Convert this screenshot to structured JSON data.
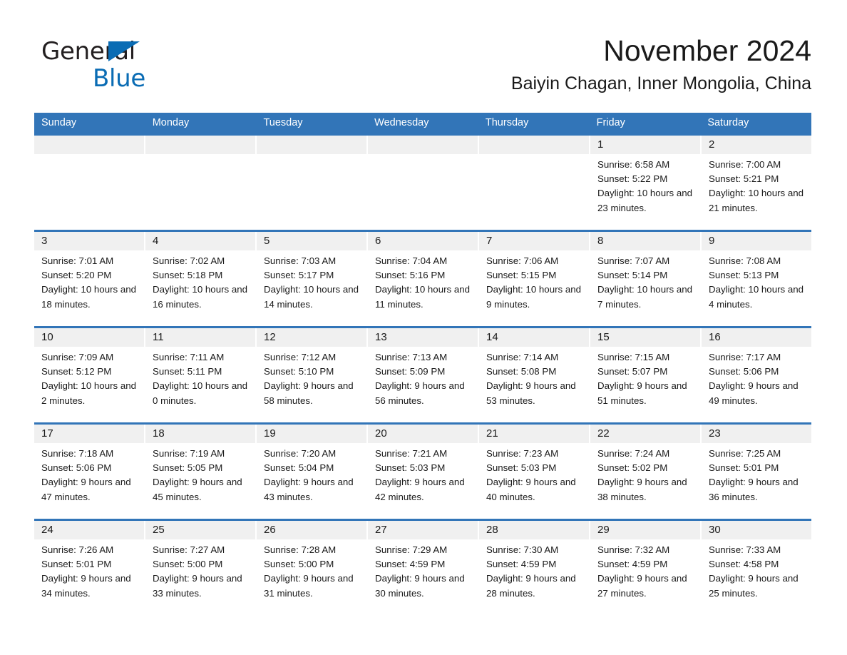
{
  "brand": {
    "name_part1": "General",
    "name_part2": "Blue",
    "accent_color": "#0a6cb4"
  },
  "header": {
    "month_title": "November 2024",
    "location": "Baiyin Chagan, Inner Mongolia, China",
    "header_bg_color": "#3275b8",
    "day_band_color": "#f0f0f0"
  },
  "weekdays": [
    "Sunday",
    "Monday",
    "Tuesday",
    "Wednesday",
    "Thursday",
    "Friday",
    "Saturday"
  ],
  "weeks": [
    {
      "days": [
        {
          "number": "",
          "sunrise": "",
          "sunset": "",
          "daylight": "",
          "empty": true
        },
        {
          "number": "",
          "sunrise": "",
          "sunset": "",
          "daylight": "",
          "empty": true
        },
        {
          "number": "",
          "sunrise": "",
          "sunset": "",
          "daylight": "",
          "empty": true
        },
        {
          "number": "",
          "sunrise": "",
          "sunset": "",
          "daylight": "",
          "empty": true
        },
        {
          "number": "",
          "sunrise": "",
          "sunset": "",
          "daylight": "",
          "empty": true
        },
        {
          "number": "1",
          "sunrise": "Sunrise: 6:58 AM",
          "sunset": "Sunset: 5:22 PM",
          "daylight": "Daylight: 10 hours and 23 minutes.",
          "empty": false
        },
        {
          "number": "2",
          "sunrise": "Sunrise: 7:00 AM",
          "sunset": "Sunset: 5:21 PM",
          "daylight": "Daylight: 10 hours and 21 minutes.",
          "empty": false
        }
      ]
    },
    {
      "days": [
        {
          "number": "3",
          "sunrise": "Sunrise: 7:01 AM",
          "sunset": "Sunset: 5:20 PM",
          "daylight": "Daylight: 10 hours and 18 minutes.",
          "empty": false
        },
        {
          "number": "4",
          "sunrise": "Sunrise: 7:02 AM",
          "sunset": "Sunset: 5:18 PM",
          "daylight": "Daylight: 10 hours and 16 minutes.",
          "empty": false
        },
        {
          "number": "5",
          "sunrise": "Sunrise: 7:03 AM",
          "sunset": "Sunset: 5:17 PM",
          "daylight": "Daylight: 10 hours and 14 minutes.",
          "empty": false
        },
        {
          "number": "6",
          "sunrise": "Sunrise: 7:04 AM",
          "sunset": "Sunset: 5:16 PM",
          "daylight": "Daylight: 10 hours and 11 minutes.",
          "empty": false
        },
        {
          "number": "7",
          "sunrise": "Sunrise: 7:06 AM",
          "sunset": "Sunset: 5:15 PM",
          "daylight": "Daylight: 10 hours and 9 minutes.",
          "empty": false
        },
        {
          "number": "8",
          "sunrise": "Sunrise: 7:07 AM",
          "sunset": "Sunset: 5:14 PM",
          "daylight": "Daylight: 10 hours and 7 minutes.",
          "empty": false
        },
        {
          "number": "9",
          "sunrise": "Sunrise: 7:08 AM",
          "sunset": "Sunset: 5:13 PM",
          "daylight": "Daylight: 10 hours and 4 minutes.",
          "empty": false
        }
      ]
    },
    {
      "days": [
        {
          "number": "10",
          "sunrise": "Sunrise: 7:09 AM",
          "sunset": "Sunset: 5:12 PM",
          "daylight": "Daylight: 10 hours and 2 minutes.",
          "empty": false
        },
        {
          "number": "11",
          "sunrise": "Sunrise: 7:11 AM",
          "sunset": "Sunset: 5:11 PM",
          "daylight": "Daylight: 10 hours and 0 minutes.",
          "empty": false
        },
        {
          "number": "12",
          "sunrise": "Sunrise: 7:12 AM",
          "sunset": "Sunset: 5:10 PM",
          "daylight": "Daylight: 9 hours and 58 minutes.",
          "empty": false
        },
        {
          "number": "13",
          "sunrise": "Sunrise: 7:13 AM",
          "sunset": "Sunset: 5:09 PM",
          "daylight": "Daylight: 9 hours and 56 minutes.",
          "empty": false
        },
        {
          "number": "14",
          "sunrise": "Sunrise: 7:14 AM",
          "sunset": "Sunset: 5:08 PM",
          "daylight": "Daylight: 9 hours and 53 minutes.",
          "empty": false
        },
        {
          "number": "15",
          "sunrise": "Sunrise: 7:15 AM",
          "sunset": "Sunset: 5:07 PM",
          "daylight": "Daylight: 9 hours and 51 minutes.",
          "empty": false
        },
        {
          "number": "16",
          "sunrise": "Sunrise: 7:17 AM",
          "sunset": "Sunset: 5:06 PM",
          "daylight": "Daylight: 9 hours and 49 minutes.",
          "empty": false
        }
      ]
    },
    {
      "days": [
        {
          "number": "17",
          "sunrise": "Sunrise: 7:18 AM",
          "sunset": "Sunset: 5:06 PM",
          "daylight": "Daylight: 9 hours and 47 minutes.",
          "empty": false
        },
        {
          "number": "18",
          "sunrise": "Sunrise: 7:19 AM",
          "sunset": "Sunset: 5:05 PM",
          "daylight": "Daylight: 9 hours and 45 minutes.",
          "empty": false
        },
        {
          "number": "19",
          "sunrise": "Sunrise: 7:20 AM",
          "sunset": "Sunset: 5:04 PM",
          "daylight": "Daylight: 9 hours and 43 minutes.",
          "empty": false
        },
        {
          "number": "20",
          "sunrise": "Sunrise: 7:21 AM",
          "sunset": "Sunset: 5:03 PM",
          "daylight": "Daylight: 9 hours and 42 minutes.",
          "empty": false
        },
        {
          "number": "21",
          "sunrise": "Sunrise: 7:23 AM",
          "sunset": "Sunset: 5:03 PM",
          "daylight": "Daylight: 9 hours and 40 minutes.",
          "empty": false
        },
        {
          "number": "22",
          "sunrise": "Sunrise: 7:24 AM",
          "sunset": "Sunset: 5:02 PM",
          "daylight": "Daylight: 9 hours and 38 minutes.",
          "empty": false
        },
        {
          "number": "23",
          "sunrise": "Sunrise: 7:25 AM",
          "sunset": "Sunset: 5:01 PM",
          "daylight": "Daylight: 9 hours and 36 minutes.",
          "empty": false
        }
      ]
    },
    {
      "days": [
        {
          "number": "24",
          "sunrise": "Sunrise: 7:26 AM",
          "sunset": "Sunset: 5:01 PM",
          "daylight": "Daylight: 9 hours and 34 minutes.",
          "empty": false
        },
        {
          "number": "25",
          "sunrise": "Sunrise: 7:27 AM",
          "sunset": "Sunset: 5:00 PM",
          "daylight": "Daylight: 9 hours and 33 minutes.",
          "empty": false
        },
        {
          "number": "26",
          "sunrise": "Sunrise: 7:28 AM",
          "sunset": "Sunset: 5:00 PM",
          "daylight": "Daylight: 9 hours and 31 minutes.",
          "empty": false
        },
        {
          "number": "27",
          "sunrise": "Sunrise: 7:29 AM",
          "sunset": "Sunset: 4:59 PM",
          "daylight": "Daylight: 9 hours and 30 minutes.",
          "empty": false
        },
        {
          "number": "28",
          "sunrise": "Sunrise: 7:30 AM",
          "sunset": "Sunset: 4:59 PM",
          "daylight": "Daylight: 9 hours and 28 minutes.",
          "empty": false
        },
        {
          "number": "29",
          "sunrise": "Sunrise: 7:32 AM",
          "sunset": "Sunset: 4:59 PM",
          "daylight": "Daylight: 9 hours and 27 minutes.",
          "empty": false
        },
        {
          "number": "30",
          "sunrise": "Sunrise: 7:33 AM",
          "sunset": "Sunset: 4:58 PM",
          "daylight": "Daylight: 9 hours and 25 minutes.",
          "empty": false
        }
      ]
    }
  ]
}
